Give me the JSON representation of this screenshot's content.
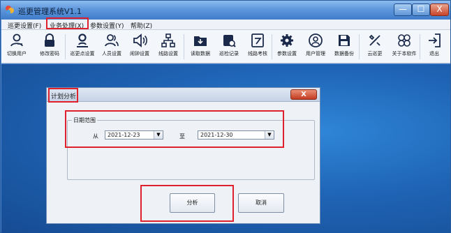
{
  "window": {
    "title": "巡更管理系统V1.1"
  },
  "window_controls": {
    "minimize": "—",
    "maximize": "☐",
    "close": "X"
  },
  "menu": {
    "items": [
      {
        "label": "巡更设置(F)"
      },
      {
        "label": "业务处理(X)"
      },
      {
        "label": "参数设置(Y)"
      },
      {
        "label": "帮助(Z)"
      }
    ]
  },
  "toolbar": {
    "items": [
      {
        "label": "切换用户",
        "icon": "switch-user-icon"
      },
      {
        "label": "修改密码",
        "icon": "lock-icon"
      },
      {
        "label": "巡更点设置",
        "icon": "location-person-icon"
      },
      {
        "label": "人员设置",
        "icon": "people-icon"
      },
      {
        "label": "闹钟设置",
        "icon": "speaker-icon"
      },
      {
        "label": "线路设置",
        "icon": "network-icon"
      },
      {
        "label": "读取数据",
        "icon": "folder-download-icon"
      },
      {
        "label": "巡检记录",
        "icon": "records-icon"
      },
      {
        "label": "线路考核",
        "icon": "edit-check-icon"
      },
      {
        "label": "参数设置",
        "icon": "gear-icon"
      },
      {
        "label": "用户管理",
        "icon": "user-manage-icon"
      },
      {
        "label": "数据备份",
        "icon": "save-icon"
      },
      {
        "label": "云巡更",
        "icon": "tools-icon"
      },
      {
        "label": "关于本软件",
        "icon": "about-icon"
      },
      {
        "label": "退出",
        "icon": "exit-icon"
      }
    ]
  },
  "dialog": {
    "title": "计划分析",
    "close": "X",
    "group_title": "日期范围",
    "from_label": "从",
    "from_value": "2021-12-23",
    "to_label": "至",
    "to_value": "2021-12-30",
    "analyze_button": "分析",
    "cancel_button": "取消"
  },
  "colors": {
    "highlight": "#e0202a",
    "desktop": "#1f64b5"
  }
}
